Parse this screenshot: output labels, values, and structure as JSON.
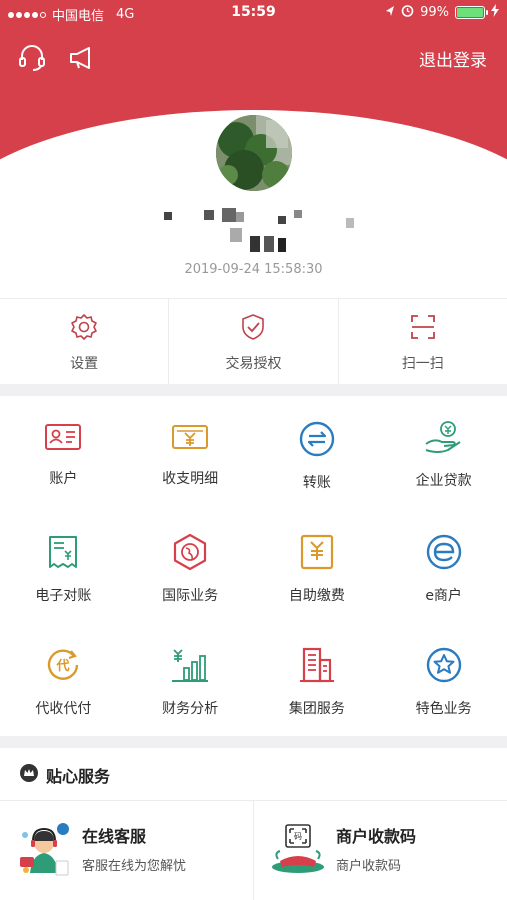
{
  "status_bar": {
    "carrier": "中国电信",
    "network": "4G",
    "time": "15:59",
    "battery": "99%",
    "battery_level": 0.99
  },
  "header": {
    "logout_label": "退出登录",
    "bg_color": "#d6404b"
  },
  "profile": {
    "timestamp": "2019-09-24 15:58:30"
  },
  "quick_actions": [
    {
      "label": "设置",
      "icon": "gear-icon"
    },
    {
      "label": "交易授权",
      "icon": "shield-check-icon"
    },
    {
      "label": "扫一扫",
      "icon": "scan-icon"
    }
  ],
  "menu_grid": [
    {
      "label": "账户",
      "icon": "id-card-icon",
      "color": "#d6404b"
    },
    {
      "label": "收支明细",
      "icon": "yen-bill-icon",
      "color": "#d99a2b"
    },
    {
      "label": "转账",
      "icon": "transfer-icon",
      "color": "#2a7bbf"
    },
    {
      "label": "企业贷款",
      "icon": "loan-hand-icon",
      "color": "#2e9c77"
    },
    {
      "label": "电子对账",
      "icon": "receipt-icon",
      "color": "#2e9c77"
    },
    {
      "label": "国际业务",
      "icon": "globe-hexagon-icon",
      "color": "#d6404b"
    },
    {
      "label": "自助缴费",
      "icon": "yen-square-icon",
      "color": "#d99a2b"
    },
    {
      "label": "e商户",
      "icon": "e-merchant-icon",
      "color": "#2a7bbf"
    },
    {
      "label": "代收代付",
      "icon": "collect-pay-icon",
      "color": "#d99a2b"
    },
    {
      "label": "财务分析",
      "icon": "bar-chart-icon",
      "color": "#2e9c77"
    },
    {
      "label": "集团服务",
      "icon": "buildings-icon",
      "color": "#d6404b"
    },
    {
      "label": "特色业务",
      "icon": "star-circle-icon",
      "color": "#2a7bbf"
    }
  ],
  "services": {
    "title": "贴心服务",
    "cards": [
      {
        "name": "在线客服",
        "subtitle": "客服在线为您解忧",
        "icon": "customer-service-icon"
      },
      {
        "name": "商户收款码",
        "subtitle": "商户收款码",
        "icon": "qr-payment-icon"
      }
    ]
  }
}
